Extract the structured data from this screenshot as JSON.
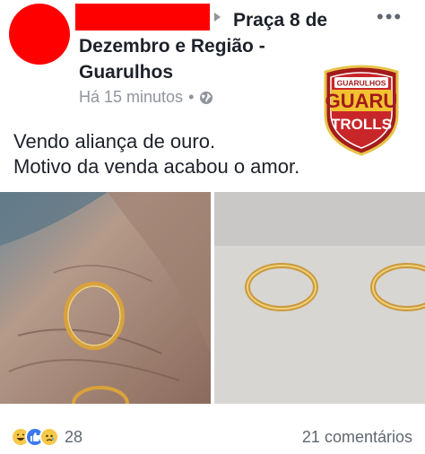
{
  "post": {
    "group_name_line1": "Praça 8 de",
    "group_name_line2": "Dezembro e Região -",
    "group_name_line3": "Guarulhos",
    "time": "Há 15 minutos",
    "separator": "•",
    "menu": "•••",
    "text_line1": "Vendo aliança de ouro.",
    "text_line2": "Motivo da venda acabou o amor."
  },
  "logo": {
    "top": "GUARULHOS",
    "middle": "GUARU",
    "bottom": "TROLLS"
  },
  "footer": {
    "reaction_count": "28",
    "comments": "21 comentários"
  },
  "colors": {
    "redacted": "#ff0000",
    "meta_gray": "#90949c",
    "like_blue": "#3b78f0",
    "emoji_yellow": "#f7c949"
  },
  "icons": [
    "globe-icon",
    "more-options-icon",
    "haha-reaction-icon",
    "like-reaction-icon",
    "sad-reaction-icon",
    "arrow-right-icon"
  ]
}
